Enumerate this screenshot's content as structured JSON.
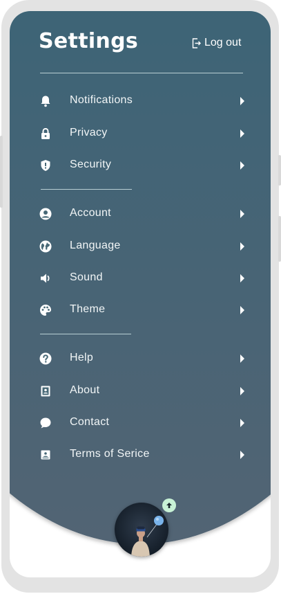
{
  "header": {
    "title": "Settings",
    "logout_label": "Log out"
  },
  "menu": {
    "groups": [
      {
        "items": [
          {
            "label": "Notifications",
            "icon": "bell-icon"
          },
          {
            "label": "Privacy",
            "icon": "lock-icon"
          },
          {
            "label": "Security",
            "icon": "shield-icon"
          }
        ]
      },
      {
        "items": [
          {
            "label": "Account",
            "icon": "user-circle-icon"
          },
          {
            "label": "Language",
            "icon": "globe-icon"
          },
          {
            "label": "Sound",
            "icon": "speaker-icon"
          },
          {
            "label": "Theme",
            "icon": "palette-icon"
          }
        ]
      },
      {
        "items": [
          {
            "label": "Help",
            "icon": "question-icon"
          },
          {
            "label": "About",
            "icon": "id-card-icon"
          },
          {
            "label": "Contact",
            "icon": "chat-bubble-icon"
          },
          {
            "label": "Terms of Serice",
            "icon": "document-icon"
          }
        ]
      }
    ]
  },
  "profile": {
    "avatar_icon": "avatar",
    "upload_icon": "arrow-up-icon"
  },
  "colors": {
    "panel_top": "#2d6578",
    "panel_bottom": "#526474",
    "text": "#ffffff",
    "badge": "#c8f2d6"
  }
}
